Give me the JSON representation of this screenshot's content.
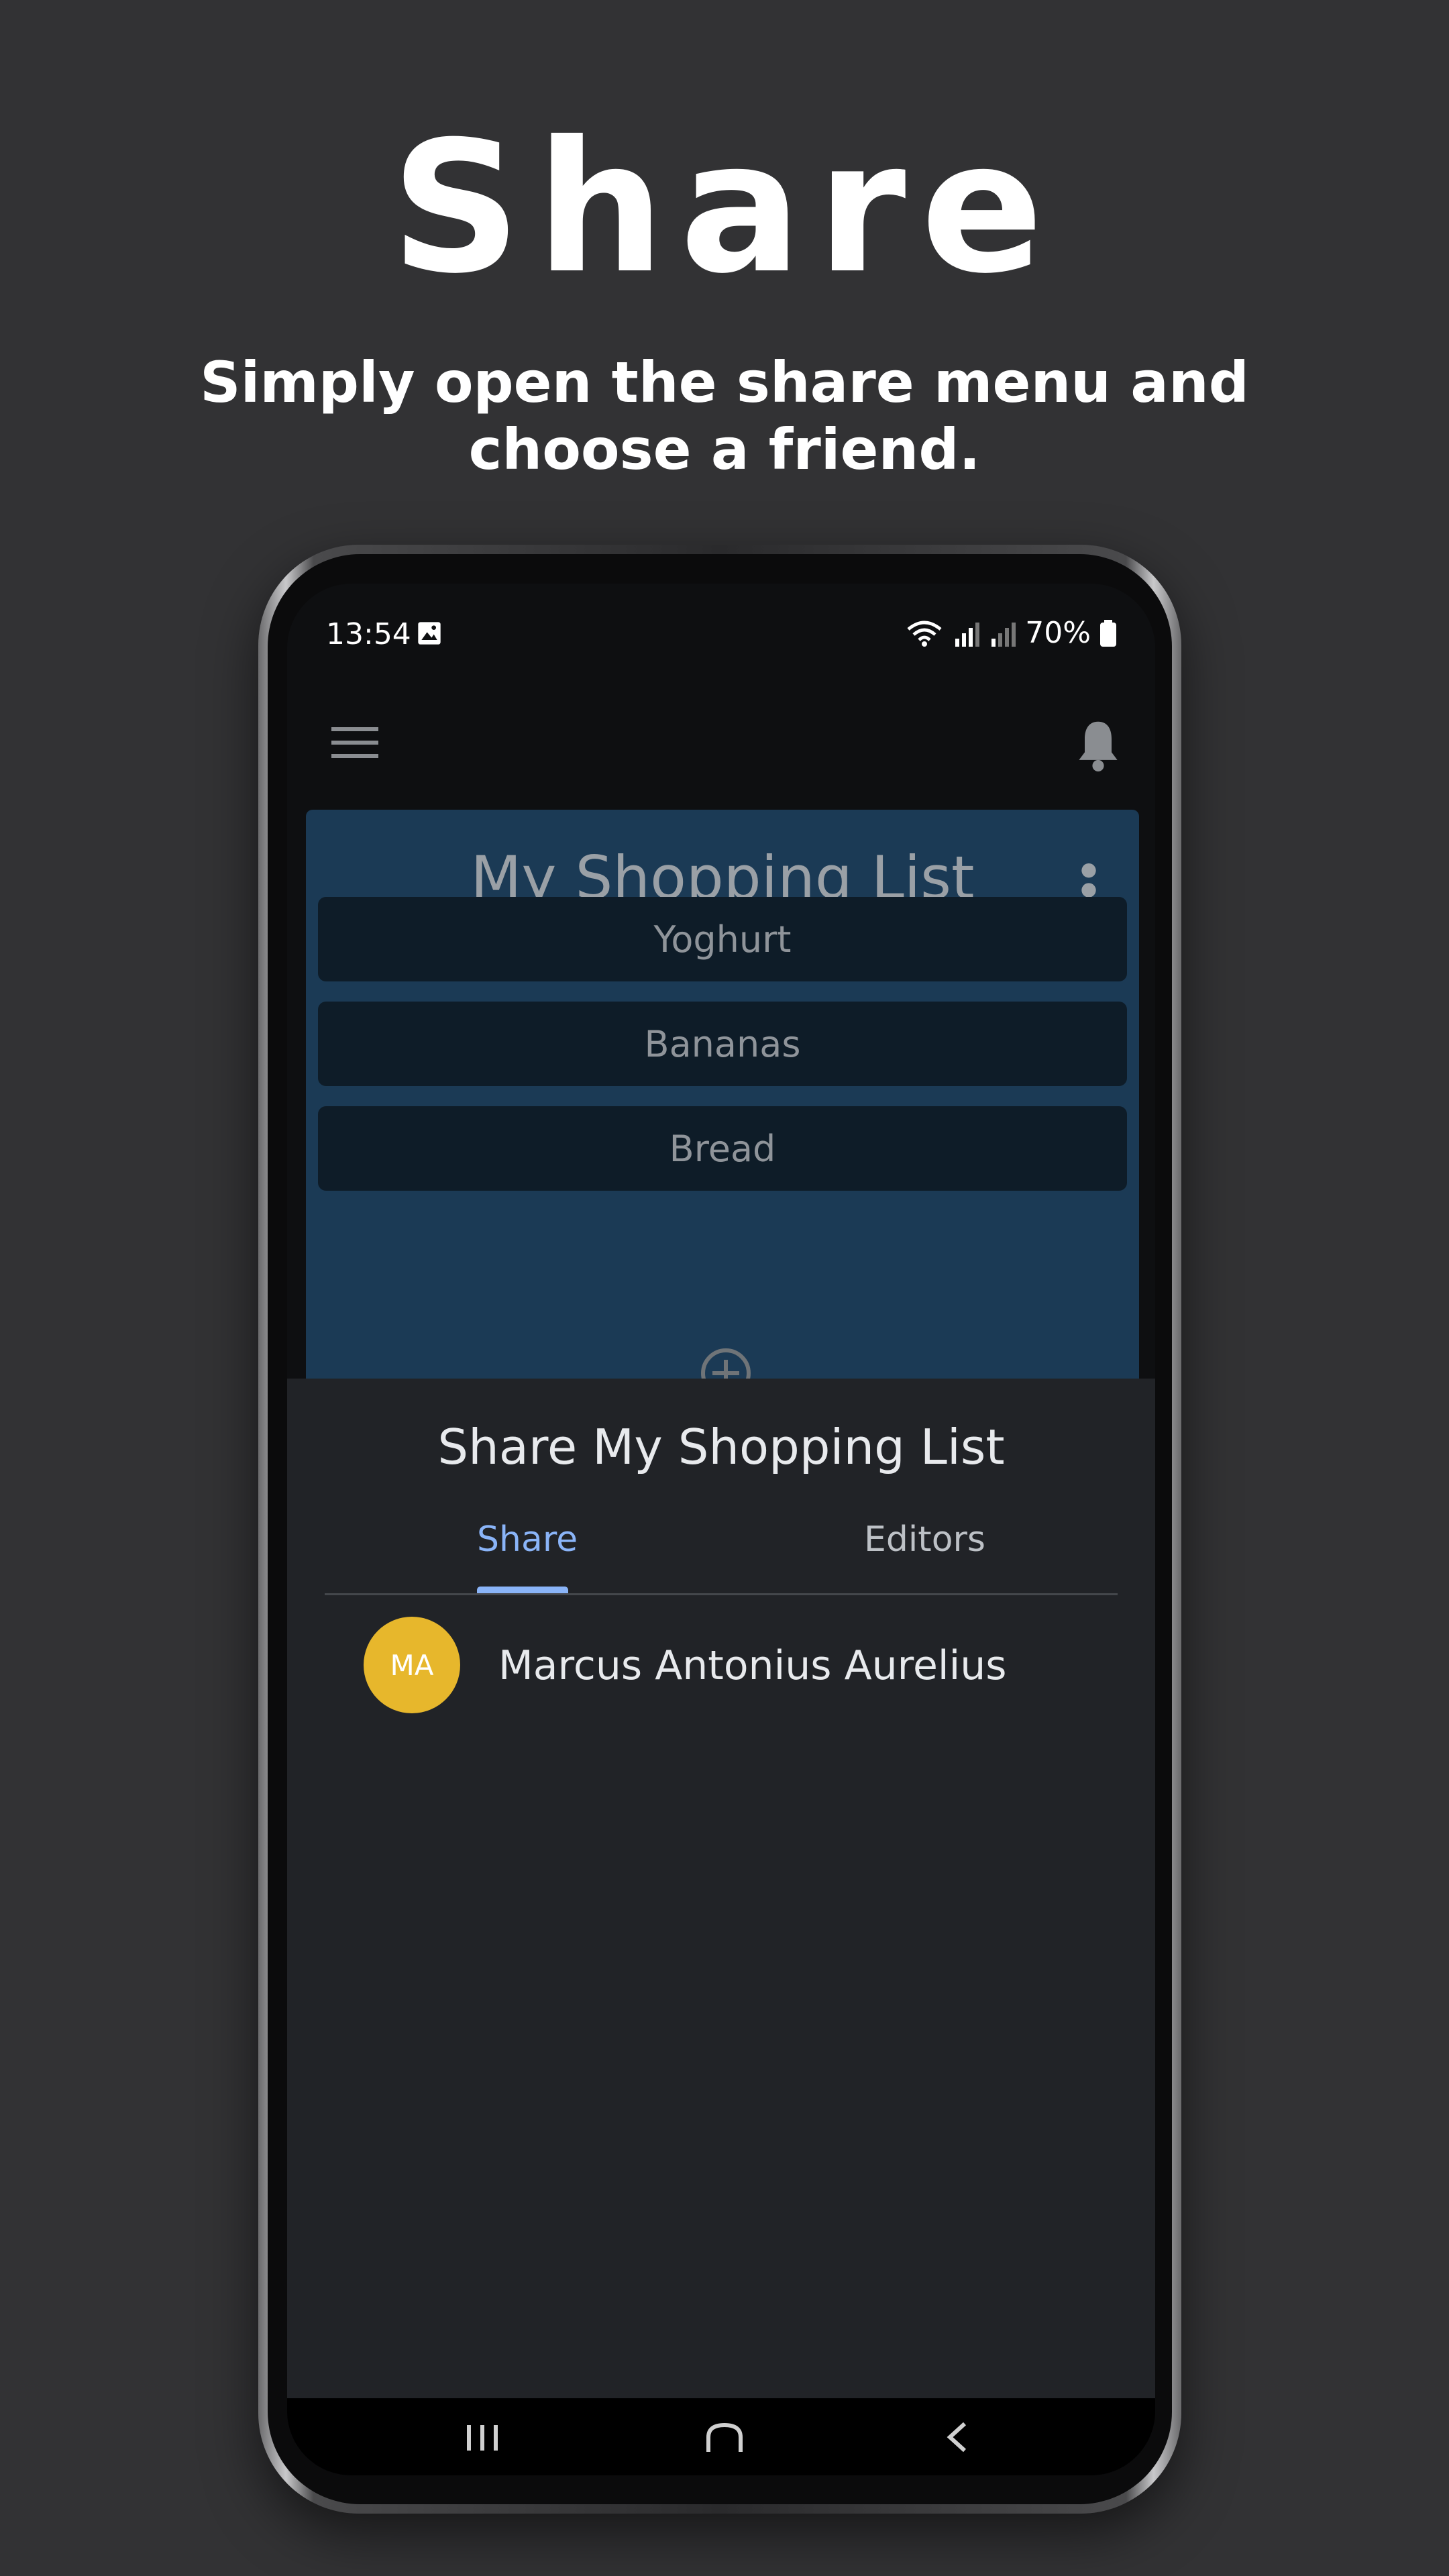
{
  "promo": {
    "headline": "Share",
    "subline": "Simply open the share menu and choose a friend."
  },
  "status_bar": {
    "time": "13:54",
    "battery": "70%"
  },
  "list": {
    "title": "My Shopping List",
    "items": [
      "Yoghurt",
      "Bananas",
      "Bread"
    ]
  },
  "share_sheet": {
    "title": "Share My Shopping List",
    "tabs": [
      {
        "label": "Share",
        "active": true
      },
      {
        "label": "Editors",
        "active": false
      }
    ],
    "friends": [
      {
        "initials": "MA",
        "name": "Marcus Antonius Aurelius",
        "avatar_color": "#e7b72c"
      }
    ]
  },
  "colors": {
    "background": "#323234",
    "list_card": "#1b3a55",
    "sheet": "#212327",
    "accent": "#8ab4f8"
  }
}
